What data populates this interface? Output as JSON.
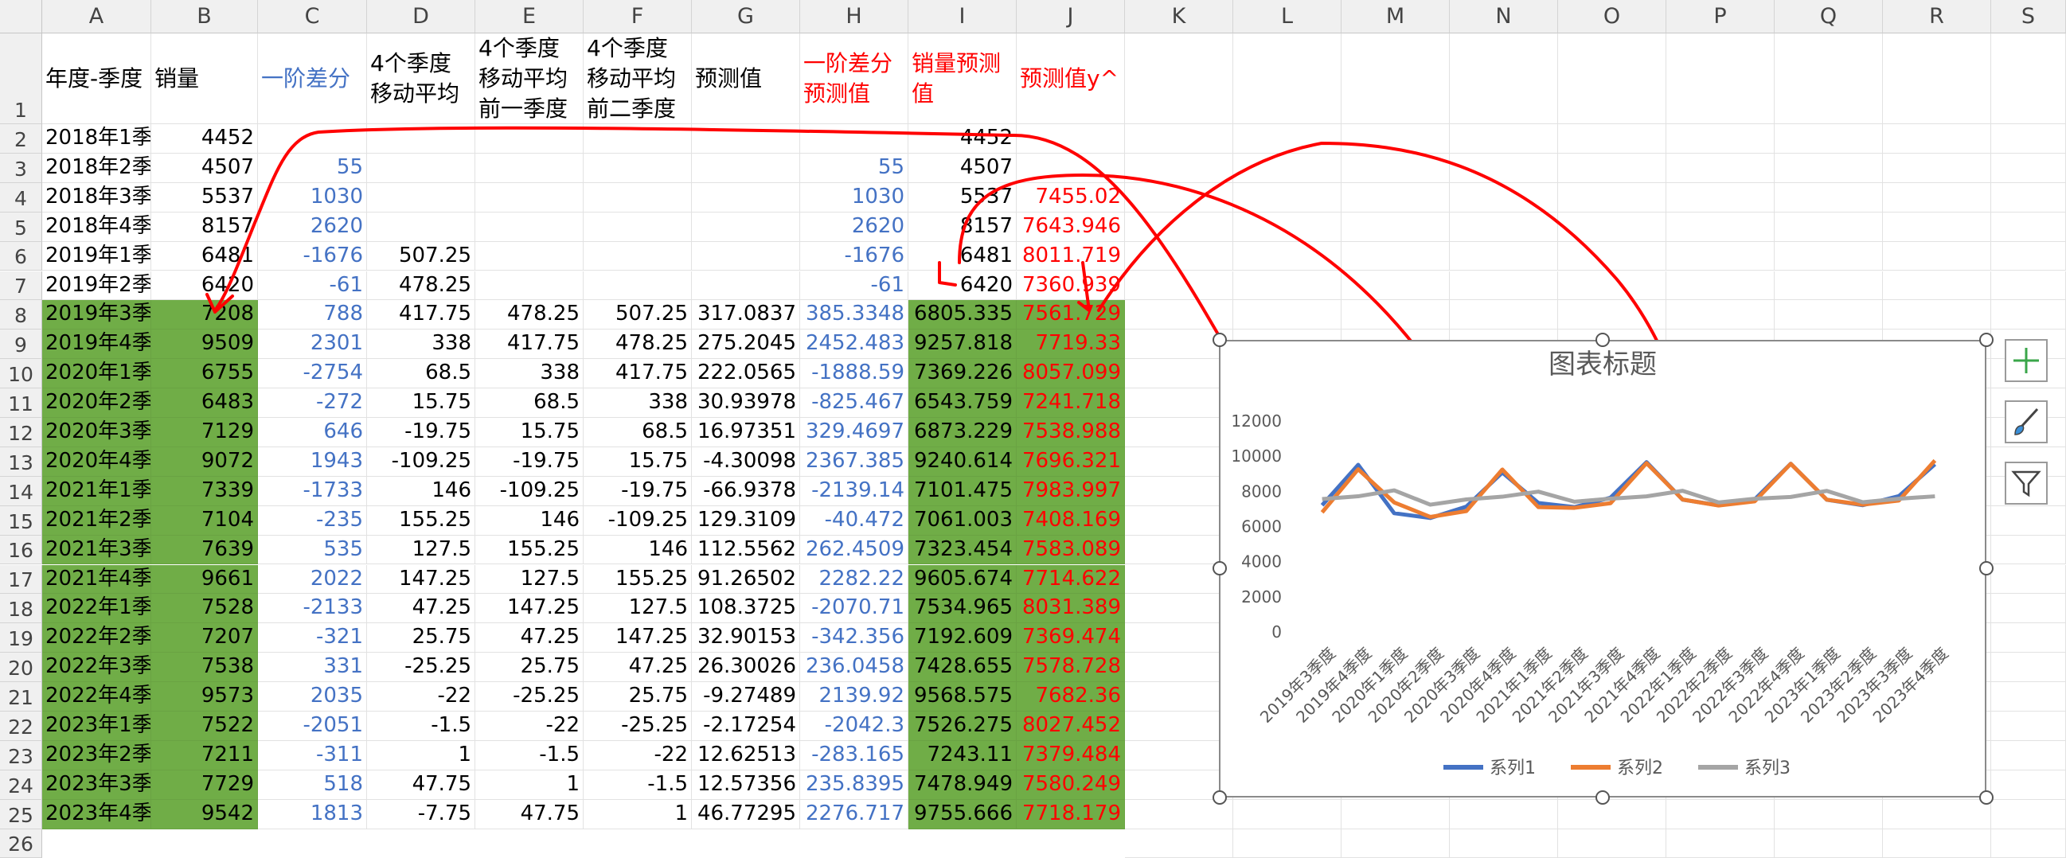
{
  "columns": [
    "A",
    "B",
    "C",
    "D",
    "E",
    "F",
    "G",
    "H",
    "I",
    "J",
    "K",
    "L",
    "M",
    "N",
    "O",
    "P",
    "Q",
    "R",
    "S"
  ],
  "rows": [
    "1",
    "2",
    "3",
    "4",
    "5",
    "6",
    "7",
    "8",
    "9",
    "10",
    "11",
    "12",
    "13",
    "14",
    "15",
    "16",
    "17",
    "18",
    "19",
    "20",
    "21",
    "22",
    "23",
    "24",
    "25",
    "26"
  ],
  "headers": {
    "a": "年度-季度",
    "b": "销量",
    "c": "一阶差分",
    "d": "4个季度移动平均",
    "e": "4个季度移动平均前一季度",
    "f": "4个季度移动平均前二季度",
    "g": "预测值",
    "h": "一阶差分预测值",
    "i": "销量预测值",
    "j": "预测值y^"
  },
  "table": [
    [
      "2018年1季",
      "4452",
      "",
      "",
      "",
      "",
      "",
      "",
      "4452",
      ""
    ],
    [
      "2018年2季",
      "4507",
      "55",
      "",
      "",
      "",
      "",
      "55",
      "4507",
      ""
    ],
    [
      "2018年3季",
      "5537",
      "1030",
      "",
      "",
      "",
      "",
      "1030",
      "5537",
      "7455.02"
    ],
    [
      "2018年4季",
      "8157",
      "2620",
      "",
      "",
      "",
      "",
      "2620",
      "8157",
      "7643.946"
    ],
    [
      "2019年1季",
      "6481",
      "-1676",
      "507.25",
      "",
      "",
      "",
      "-1676",
      "6481",
      "8011.719"
    ],
    [
      "2019年2季",
      "6420",
      "-61",
      "478.25",
      "",
      "",
      "",
      "-61",
      "6420",
      "7360.939"
    ],
    [
      "2019年3季",
      "7208",
      "788",
      "417.75",
      "478.25",
      "507.25",
      "317.0837",
      "385.3348",
      "6805.335",
      "7561.729"
    ],
    [
      "2019年4季",
      "9509",
      "2301",
      "338",
      "417.75",
      "478.25",
      "275.2045",
      "2452.483",
      "9257.818",
      "7719.33"
    ],
    [
      "2020年1季",
      "6755",
      "-2754",
      "68.5",
      "338",
      "417.75",
      "222.0565",
      "-1888.59",
      "7369.226",
      "8057.099"
    ],
    [
      "2020年2季",
      "6483",
      "-272",
      "15.75",
      "68.5",
      "338",
      "30.93978",
      "-825.467",
      "6543.759",
      "7241.718"
    ],
    [
      "2020年3季",
      "7129",
      "646",
      "-19.75",
      "15.75",
      "68.5",
      "16.97351",
      "329.4697",
      "6873.229",
      "7538.988"
    ],
    [
      "2020年4季",
      "9072",
      "1943",
      "-109.25",
      "-19.75",
      "15.75",
      "-4.30098",
      "2367.385",
      "9240.614",
      "7696.321"
    ],
    [
      "2021年1季",
      "7339",
      "-1733",
      "146",
      "-109.25",
      "-19.75",
      "-66.9378",
      "-2139.14",
      "7101.475",
      "7983.997"
    ],
    [
      "2021年2季",
      "7104",
      "-235",
      "155.25",
      "146",
      "-109.25",
      "129.3109",
      "-40.472",
      "7061.003",
      "7408.169"
    ],
    [
      "2021年3季",
      "7639",
      "535",
      "127.5",
      "155.25",
      "146",
      "112.5562",
      "262.4509",
      "7323.454",
      "7583.089"
    ],
    [
      "2021年4季",
      "9661",
      "2022",
      "147.25",
      "127.5",
      "155.25",
      "91.26502",
      "2282.22",
      "9605.674",
      "7714.622"
    ],
    [
      "2022年1季",
      "7528",
      "-2133",
      "47.25",
      "147.25",
      "127.5",
      "108.3725",
      "-2070.71",
      "7534.965",
      "8031.389"
    ],
    [
      "2022年2季",
      "7207",
      "-321",
      "25.75",
      "47.25",
      "147.25",
      "32.90153",
      "-342.356",
      "7192.609",
      "7369.474"
    ],
    [
      "2022年3季",
      "7538",
      "331",
      "-25.25",
      "25.75",
      "47.25",
      "26.30026",
      "236.0458",
      "7428.655",
      "7578.728"
    ],
    [
      "2022年4季",
      "9573",
      "2035",
      "-22",
      "-25.25",
      "25.75",
      "-9.27489",
      "2139.92",
      "9568.575",
      "7682.36"
    ],
    [
      "2023年1季",
      "7522",
      "-2051",
      "-1.5",
      "-22",
      "-25.25",
      "-2.17254",
      "-2042.3",
      "7526.275",
      "8027.452"
    ],
    [
      "2023年2季",
      "7211",
      "-311",
      "1",
      "-1.5",
      "-22",
      "12.62513",
      "-283.165",
      "7243.11",
      "7379.484"
    ],
    [
      "2023年3季",
      "7729",
      "518",
      "47.75",
      "1",
      "-1.5",
      "12.57356",
      "235.8395",
      "7478.949",
      "7580.249"
    ],
    [
      "2023年4季",
      "9542",
      "1813",
      "-7.75",
      "47.75",
      "1",
      "46.77295",
      "2276.717",
      "9755.666",
      "7718.179"
    ]
  ],
  "side_buttons": {
    "add": "chart-elements-icon",
    "style": "chart-styles-icon",
    "filter": "chart-filters-icon"
  },
  "chart_data": {
    "type": "line",
    "title": "图表标题",
    "categories": [
      "2019年3季度",
      "2019年4季度",
      "2020年1季度",
      "2020年2季度",
      "2020年3季度",
      "2020年4季度",
      "2021年1季度",
      "2021年2季度",
      "2021年3季度",
      "2021年4季度",
      "2022年1季度",
      "2022年2季度",
      "2022年3季度",
      "2022年4季度",
      "2023年1季度",
      "2023年2季度",
      "2023年3季度",
      "2023年4季度"
    ],
    "yticks": [
      "0",
      "2000",
      "4000",
      "6000",
      "8000",
      "10000",
      "12000"
    ],
    "ylim": [
      0,
      12000
    ],
    "legend_position": "bottom",
    "grid": false,
    "series": [
      {
        "name": "系列1",
        "color": "#4472c4",
        "values": [
          7208,
          9509,
          6755,
          6483,
          7129,
          9072,
          7339,
          7104,
          7639,
          9661,
          7528,
          7207,
          7538,
          9573,
          7522,
          7211,
          7729,
          9542
        ]
      },
      {
        "name": "系列2",
        "color": "#ed7d31",
        "values": [
          6805.335,
          9257.818,
          7369.226,
          6543.759,
          6873.229,
          9240.614,
          7101.475,
          7061.003,
          7323.454,
          9605.674,
          7534.965,
          7192.609,
          7428.655,
          9568.575,
          7526.275,
          7243.11,
          7478.949,
          9755.666
        ]
      },
      {
        "name": "系列3",
        "color": "#a5a5a5",
        "values": [
          7561.729,
          7719.33,
          8057.099,
          7241.718,
          7538.988,
          7696.321,
          7983.997,
          7408.169,
          7583.089,
          7714.622,
          8031.389,
          7369.474,
          7578.728,
          7682.36,
          8027.452,
          7379.484,
          7580.249,
          7718.179
        ]
      }
    ]
  }
}
